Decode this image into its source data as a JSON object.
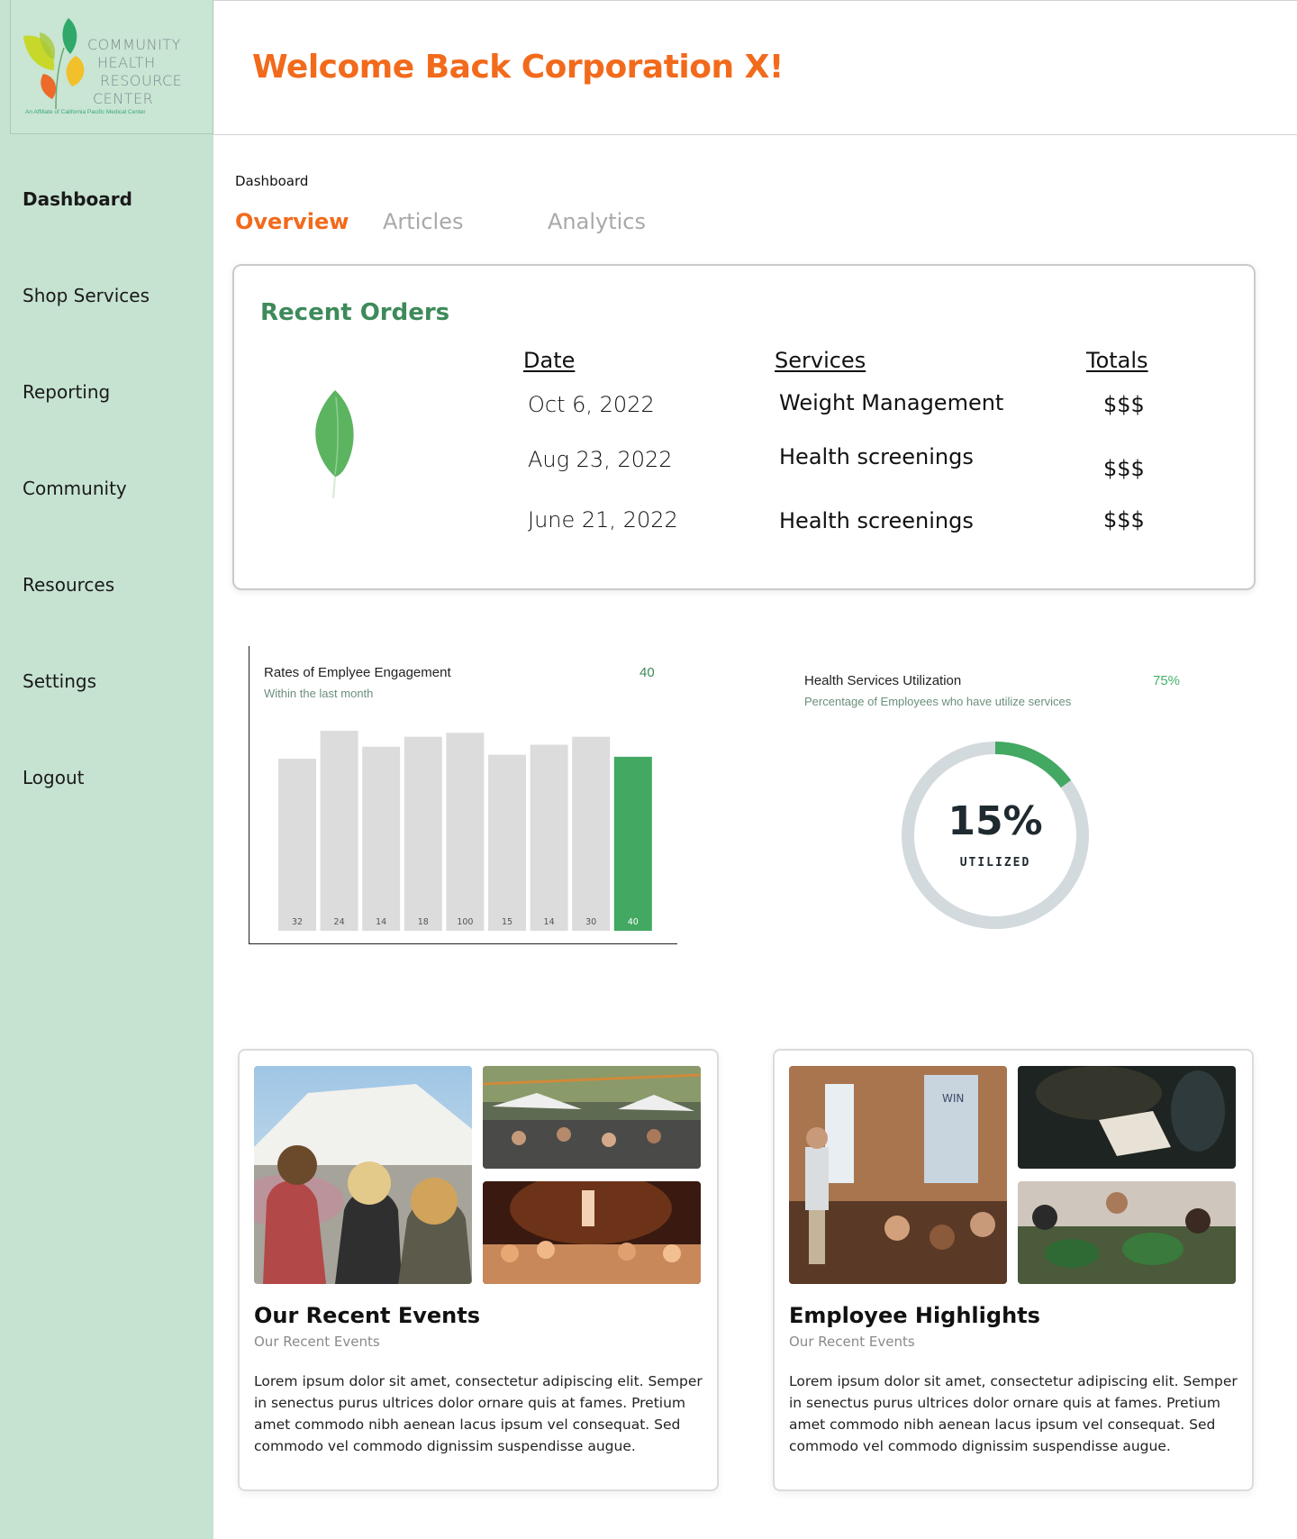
{
  "logo": {
    "line1": "COMMUNITY",
    "line2": "HEALTH",
    "line3": "RESOURCE",
    "line4": "CENTER",
    "tagline": "An Affiliate of California Pacific Medical Center"
  },
  "sidebar": {
    "items": [
      {
        "label": "Dashboard"
      },
      {
        "label": "Shop Services"
      },
      {
        "label": "Reporting"
      },
      {
        "label": "Community"
      },
      {
        "label": "Resources"
      },
      {
        "label": "Settings"
      },
      {
        "label": "Logout"
      }
    ]
  },
  "header": {
    "title": "Welcome Back Corporation X!"
  },
  "breadcrumb": "Dashboard",
  "tabs": [
    {
      "label": "Overview"
    },
    {
      "label": "Articles"
    },
    {
      "label": "Analytics"
    }
  ],
  "orders": {
    "title": "Recent Orders",
    "columns": [
      "Date",
      "Services",
      "Totals"
    ],
    "rows": [
      {
        "date": "Oct 6, 2022",
        "service": "Weight Management",
        "total": "$$$"
      },
      {
        "date": "Aug 23, 2022",
        "service": "Health screenings",
        "total": "$$$"
      },
      {
        "date": "June 21, 2022",
        "service": "Health screenings",
        "total": "$$$"
      }
    ]
  },
  "engagement": {
    "title": "Rates of Emplyee Engagement",
    "subtitle": "Within the last month",
    "value": "40"
  },
  "utilization": {
    "title": "Health Services Utilization",
    "subtitle": "Percentage of Employees who have utilize services",
    "value": "75%",
    "center_value": "15%",
    "center_label": "UTILIZED",
    "fraction": 0.15
  },
  "chart_data": {
    "type": "bar",
    "title": "Rates of Emplyee Engagement",
    "subtitle": "Within the last month",
    "bar_labels": [
      "32",
      "24",
      "14",
      "18",
      "100",
      "15",
      "14",
      "30",
      "40"
    ],
    "relative_heights": [
      0.86,
      1.0,
      0.92,
      0.97,
      0.99,
      0.88,
      0.93,
      0.97,
      0.87
    ],
    "highlight_index": 8,
    "colors": {
      "default": "#dcdcdd",
      "highlight": "#42a862"
    }
  },
  "cards": [
    {
      "title": "Our Recent Events",
      "subtitle": "Our Recent Events",
      "body": "Lorem ipsum dolor sit amet, consectetur adipiscing elit. Semper in senectus purus ultrices dolor ornare quis at fames. Pretium amet commodo nibh aenean lacus ipsum vel consequat. Sed commodo vel commodo dignissim suspendisse augue."
    },
    {
      "title": "Employee Highlights",
      "subtitle": "Our Recent Events",
      "body": "Lorem ipsum dolor sit amet, consectetur adipiscing elit. Semper in senectus purus ultrices dolor ornare quis at fames. Pretium amet commodo nibh aenean lacus ipsum vel consequat. Sed commodo vel commodo dignissim suspendisse augue."
    }
  ],
  "colors": {
    "sidebar_bg": "#c6e3d1",
    "accent_orange": "#f26a1b",
    "accent_green": "#3d8a5a"
  }
}
